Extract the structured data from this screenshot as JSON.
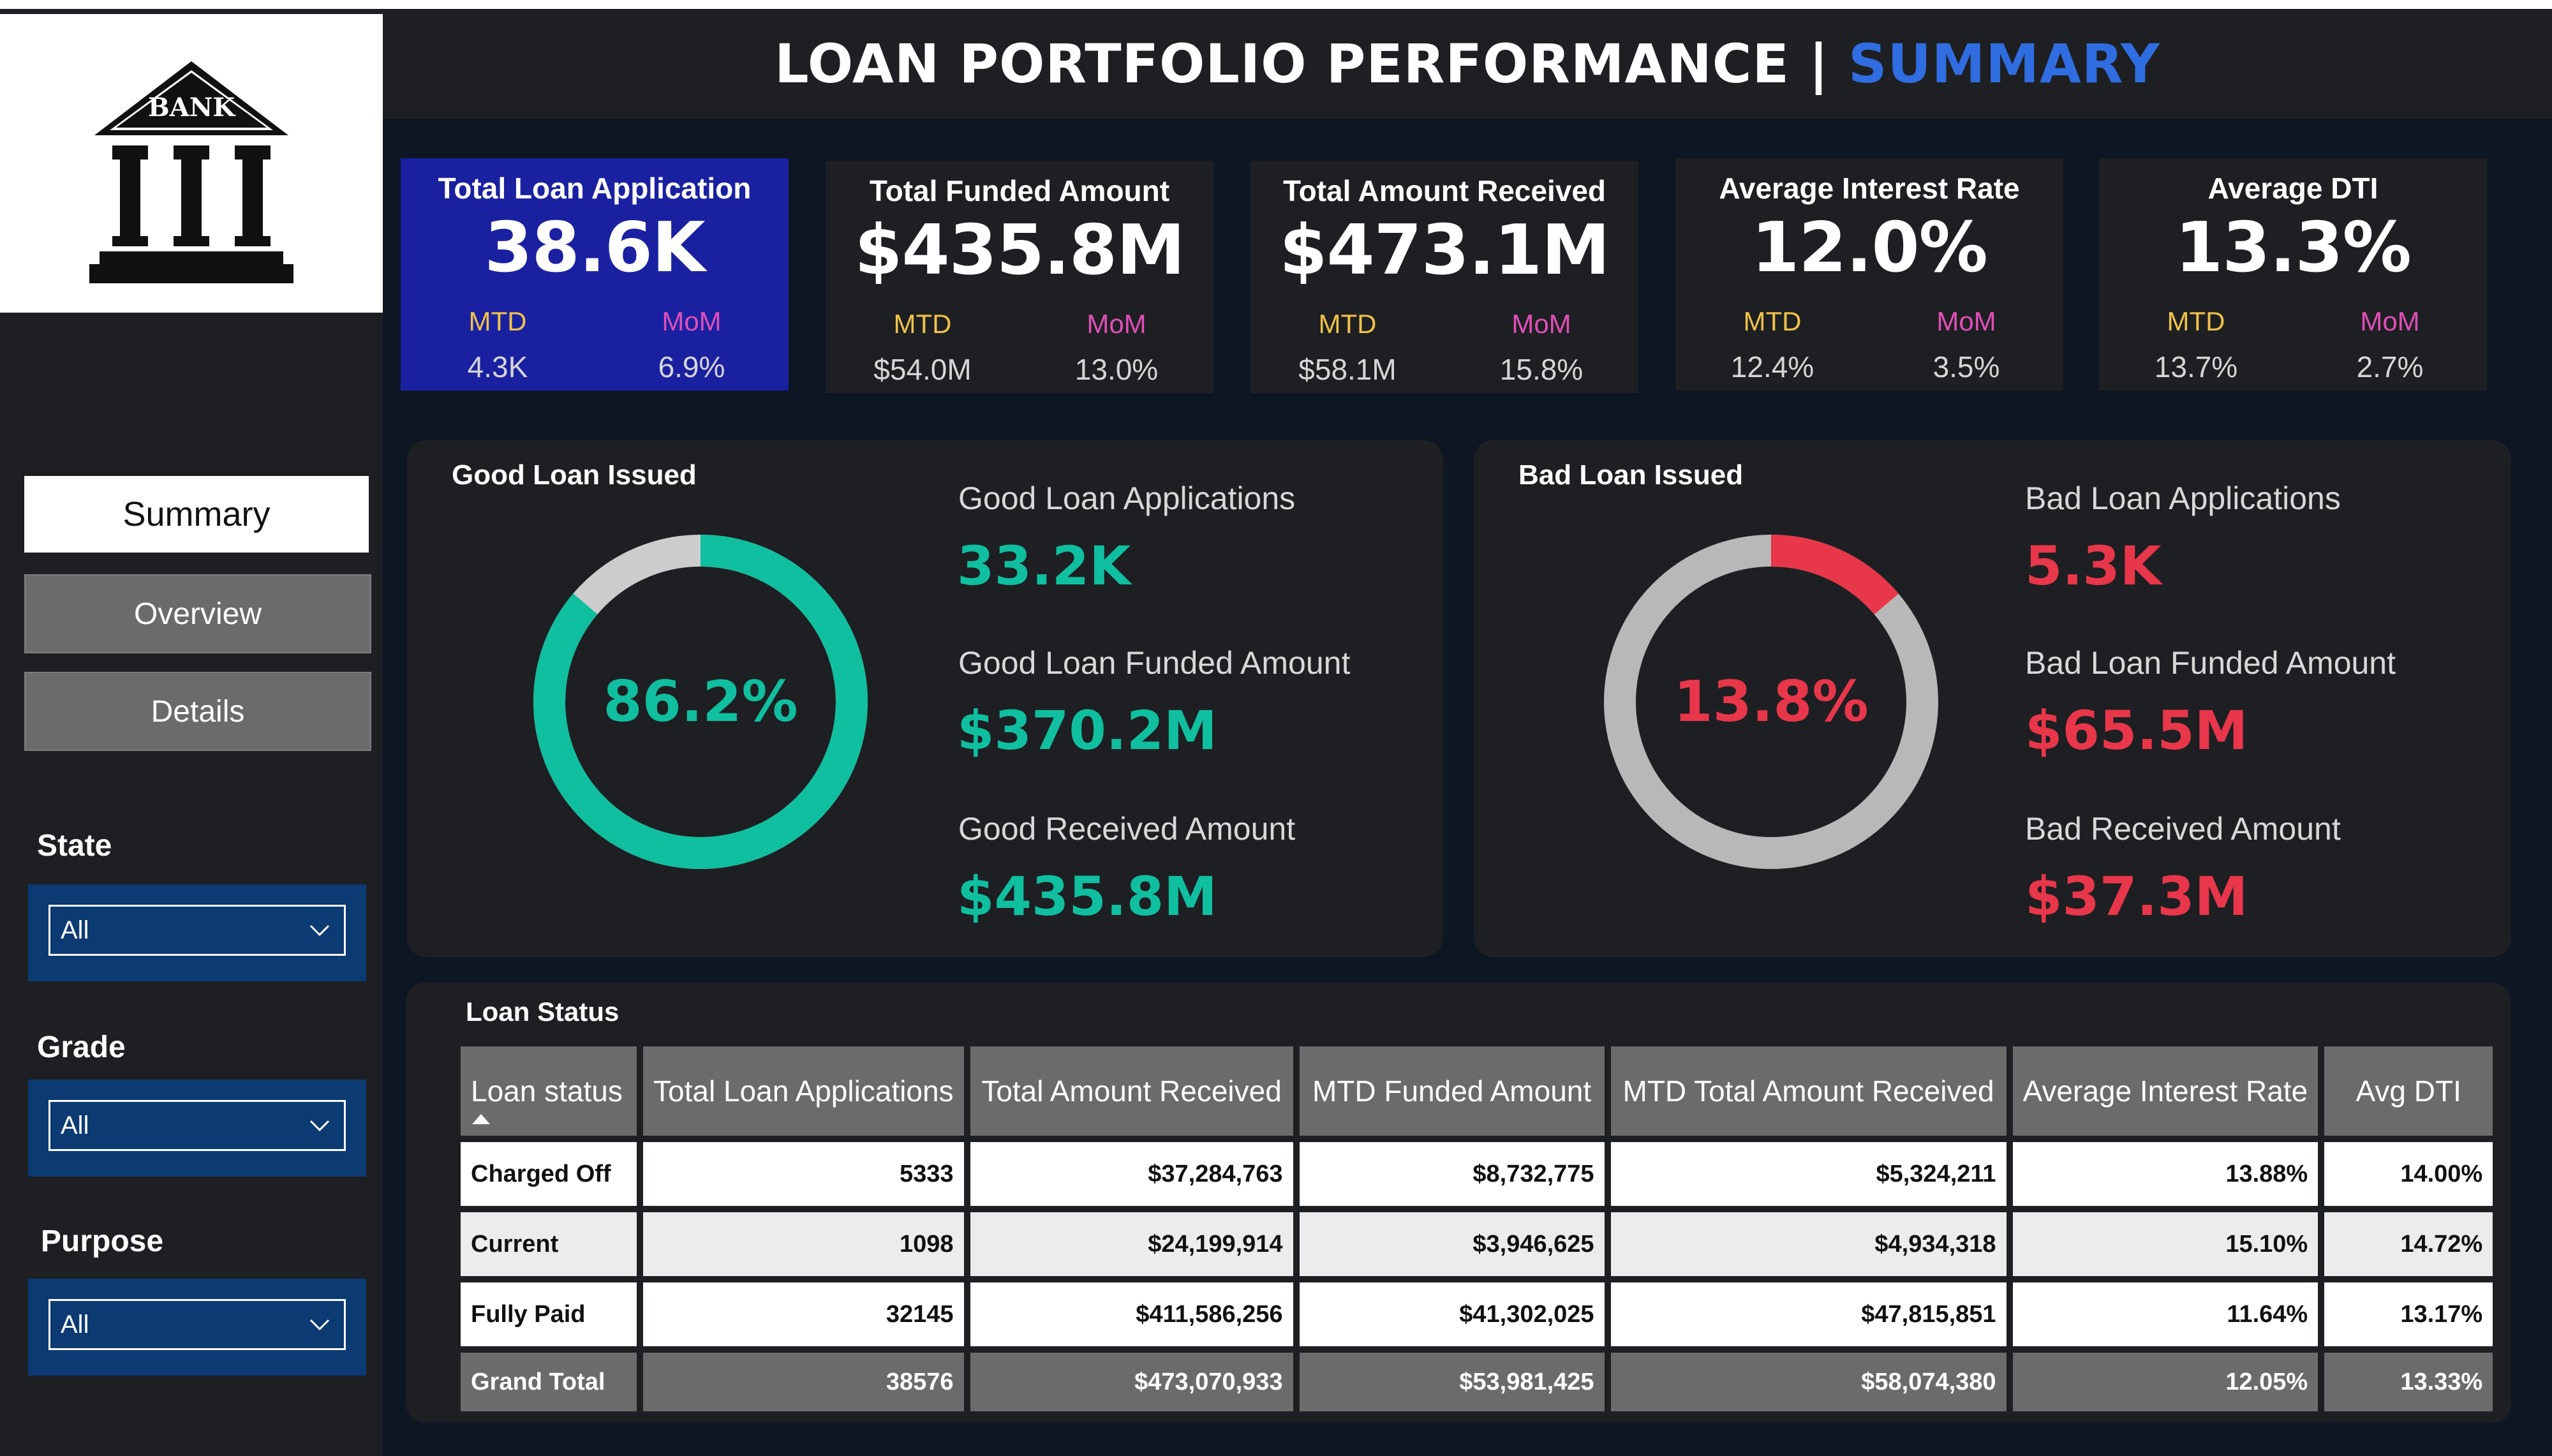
{
  "header": {
    "title_main": "LOAN PORTFOLIO PERFORMANCE | ",
    "title_accent": "SUMMARY",
    "accent_color": "#2f6de0"
  },
  "logo": {
    "text": "BANK"
  },
  "kpis": [
    {
      "title": "Total Loan Application",
      "value": "38.6K",
      "mtd_label": "MTD",
      "mom_label": "MoM",
      "mtd": "4.3K",
      "mom": "6.9%",
      "active": true
    },
    {
      "title": "Total Funded Amount",
      "value": "$435.8M",
      "mtd_label": "MTD",
      "mom_label": "MoM",
      "mtd": "$54.0M",
      "mom": "13.0%"
    },
    {
      "title": "Total  Amount Received",
      "value": "$473.1M",
      "mtd_label": "MTD",
      "mom_label": "MoM",
      "mtd": "$58.1M",
      "mom": "15.8%"
    },
    {
      "title": "Average Interest Rate",
      "value": "12.0%",
      "mtd_label": "MTD",
      "mom_label": "MoM",
      "mtd": "12.4%",
      "mom": "3.5%"
    },
    {
      "title": "Average DTI",
      "value": "13.3%",
      "mtd_label": "MTD",
      "mom_label": "MoM",
      "mtd": "13.7%",
      "mom": "2.7%"
    }
  ],
  "nav": {
    "summary": "Summary",
    "overview": "Overview",
    "details": "Details"
  },
  "filters": [
    {
      "label": "State",
      "value": "All"
    },
    {
      "label": "Grade",
      "value": "All"
    },
    {
      "label": "Purpose",
      "value": "All"
    }
  ],
  "good_loan": {
    "title": "Good Loan Issued",
    "percent_label": "86.2%",
    "percent": 86.2,
    "color": "#0fbf9f",
    "apps_label": "Good Loan Applications",
    "apps": "33.2K",
    "funded_label": "Good Loan Funded Amount",
    "funded": "$370.2M",
    "received_label": "Good Received Amount",
    "received": "$435.8M"
  },
  "bad_loan": {
    "title": "Bad Loan Issued",
    "percent_label": "13.8%",
    "percent": 13.8,
    "color": "#e8364a",
    "apps_label": "Bad Loan Applications",
    "apps": "5.3K",
    "funded_label": "Bad Loan Funded Amount",
    "funded": "$65.5M",
    "received_label": "Bad Received Amount",
    "received": "$37.3M"
  },
  "loan_status": {
    "title": "Loan Status",
    "headers": [
      "Loan status",
      "Total Loan Applications",
      "Total Amount Received",
      "MTD Funded Amount",
      "MTD Total Amount Received",
      "Average Interest Rate",
      "Avg DTI"
    ],
    "rows": [
      [
        "Charged Off",
        "5333",
        "$37,284,763",
        "$8,732,775",
        "$5,324,211",
        "13.88%",
        "14.00%"
      ],
      [
        "Current",
        "1098",
        "$24,199,914",
        "$3,946,625",
        "$4,934,318",
        "15.10%",
        "14.72%"
      ],
      [
        "Fully Paid",
        "32145",
        "$411,586,256",
        "$41,302,025",
        "$47,815,851",
        "11.64%",
        "13.17%"
      ]
    ],
    "total": [
      "Grand Total",
      "38576",
      "$473,070,933",
      "$53,981,425",
      "$58,074,380",
      "12.05%",
      "13.33%"
    ]
  }
}
